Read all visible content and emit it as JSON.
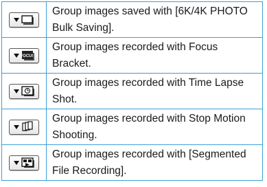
{
  "rows": [
    {
      "icon": "group-6k4k-photo-icon",
      "text": "Group images saved with [6K/4K PHOTO Bulk Saving]."
    },
    {
      "icon": "group-focus-bracket-icon",
      "text": "Group images recorded with Focus Bracket."
    },
    {
      "icon": "group-time-lapse-icon",
      "text": "Group images recorded with Time Lapse Shot."
    },
    {
      "icon": "group-stop-motion-icon",
      "text": "Group images recorded with Stop Motion Shooting."
    },
    {
      "icon": "group-segmented-file-icon",
      "text": "Group images recorded with [Segmented File Recording]."
    }
  ],
  "icon_label": {
    "focus": "FOCUS"
  },
  "colors": {
    "border": "#3a9fd6",
    "text": "#1a1a1a"
  }
}
